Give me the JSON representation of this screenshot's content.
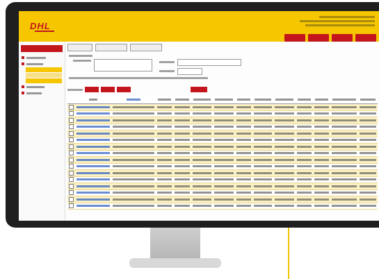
{
  "app": {
    "logo_text": "DHL",
    "header_info": [
      "—",
      "—"
    ],
    "header_buttons": [
      "—",
      "—",
      "—",
      "—"
    ]
  },
  "sidebar": {
    "title": "—",
    "items": [
      "—",
      "—",
      "—",
      "—",
      "—",
      "—",
      "—",
      "—"
    ]
  },
  "toolbar": {
    "buttons": [
      "—",
      "—",
      "—"
    ]
  },
  "filter": {
    "labels": [
      "—",
      "—",
      "—",
      "—",
      "—"
    ],
    "actions": [
      "—",
      "—",
      "—",
      "—"
    ]
  },
  "table": {
    "columns": [
      "",
      "—",
      "—",
      "—",
      "—",
      "—",
      "—",
      "—",
      "—",
      "—",
      "—",
      "—",
      "—",
      "—"
    ],
    "row_count": 16,
    "cell_placeholder": "—"
  },
  "colors": {
    "accent": "#f6c700",
    "brand": "#c3161c"
  }
}
